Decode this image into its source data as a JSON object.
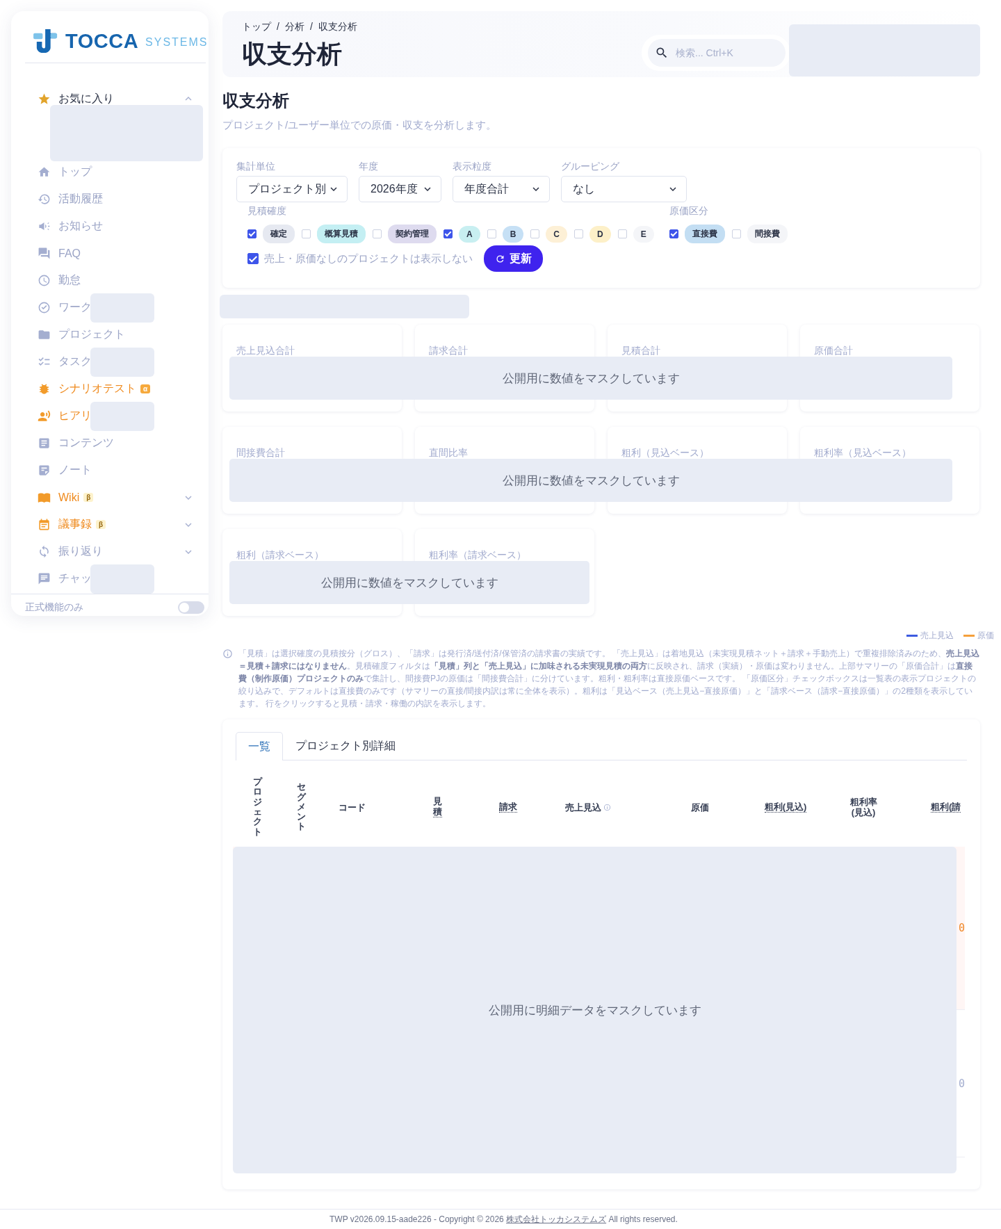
{
  "sidebar": {
    "logo": {
      "primary": "TOCCA",
      "secondary": "SYSTEMS"
    },
    "favorites": {
      "label": "お気に入り",
      "expanded": true,
      "masked": true
    },
    "items": [
      {
        "label": "トップ",
        "accent": false,
        "masked": false
      },
      {
        "label": "活動履歴",
        "accent": false,
        "masked": false
      },
      {
        "label": "お知らせ",
        "accent": false,
        "masked": false
      },
      {
        "label": "FAQ",
        "accent": false,
        "masked": false
      },
      {
        "label": "勤怠",
        "accent": false,
        "masked": false
      },
      {
        "label": "ワーク",
        "accent": false,
        "masked": true
      },
      {
        "label": "プロジェクト",
        "accent": false,
        "masked": false
      },
      {
        "label": "タスク",
        "accent": false,
        "masked": true
      },
      {
        "label": "シナリオテスト",
        "accent": true,
        "masked": false,
        "badge": {
          "text": "α",
          "kind": "solid"
        }
      },
      {
        "label": "ヒアリ",
        "accent": true,
        "masked": true
      },
      {
        "label": "コンテンツ",
        "accent": false,
        "masked": false
      },
      {
        "label": "ノート",
        "accent": false,
        "masked": false
      },
      {
        "label": "Wiki",
        "accent": true,
        "masked": false,
        "badge": {
          "text": "β",
          "kind": "soft"
        },
        "expanded": false
      },
      {
        "label": "議事録",
        "accent": true,
        "masked": false,
        "badge": {
          "text": "β",
          "kind": "soft"
        },
        "expanded": false
      },
      {
        "label": "振り返り",
        "accent": false,
        "masked": false,
        "expanded": false
      },
      {
        "label": "チャッ",
        "accent": false,
        "masked": true
      }
    ],
    "toggle": {
      "label": "正式機能のみ",
      "on": false
    }
  },
  "header": {
    "breadcrumb": [
      "トップ",
      "分析",
      "収支分析"
    ],
    "breadcrumb_separator": "/",
    "title": "収支分析",
    "search": {
      "placeholder": "検索... Ctrl+K"
    }
  },
  "page": {
    "title": "収支分析",
    "subtitle": "プロジェクト/ユーザー単位での原価・収支を分析します。"
  },
  "filters": {
    "selects": [
      {
        "label": "集計単位",
        "value": "プロジェクト別"
      },
      {
        "label": "年度",
        "value": "2026年度"
      },
      {
        "label": "表示粒度",
        "value": "年度合計"
      },
      {
        "label": "グルーピング",
        "value": "なし"
      }
    ],
    "groups": [
      {
        "label": "見積確度",
        "chips": [
          {
            "label": "確定",
            "checked": true,
            "color": "#e6e9f1"
          },
          {
            "label": "概算見積",
            "checked": false,
            "color": "#c4eff3"
          },
          {
            "label": "契約管理",
            "checked": false,
            "color": "#dedbef"
          },
          {
            "label": "A",
            "checked": true,
            "color": "#c8eff1"
          },
          {
            "label": "B",
            "checked": false,
            "color": "#c6e0f5"
          },
          {
            "label": "C",
            "checked": false,
            "color": "#fdf0d6"
          },
          {
            "label": "D",
            "checked": false,
            "color": "#fdf0c8"
          },
          {
            "label": "E",
            "checked": false,
            "color": "#f4f5f8"
          }
        ]
      },
      {
        "label": "原価区分",
        "chips": [
          {
            "label": "直接費",
            "checked": true,
            "color": "#c3def3"
          },
          {
            "label": "間接費",
            "checked": false,
            "color": "#f4f5f8"
          }
        ]
      }
    ],
    "hide_empty": {
      "label": "売上・原価なしのプロジェクトは表示しない",
      "checked": true
    },
    "refresh_button": "更新"
  },
  "summary": [
    {
      "cards": [
        "売上見込合計",
        "請求合計",
        "見積合計",
        "原価合計"
      ],
      "mask": "公開用に数値をマスクしています"
    },
    {
      "cards": [
        "間接費合計",
        "直間比率",
        "粗利（見込ベース）",
        "粗利率（見込ベース）"
      ],
      "mask": "公開用に数値をマスクしています"
    },
    {
      "cards": [
        "粗利（請求ベース）",
        "粗利率（請求ベース）"
      ],
      "mask": "公開用に数値をマスクしています"
    }
  ],
  "legend": [
    {
      "label": "売上見込",
      "color": "#3d5be0"
    },
    {
      "label": "原価",
      "color": "#f5a03c"
    }
  ],
  "note": "「見積」は選択確度の見積按分（グロス）、「請求」は発行済/送付済/保管済の請求書の実績です。 「売上見込」は着地見込（未実現見積ネット＋請求＋手動売上）で重複排除済みのため、**売上見込＝見積＋請求にはなりません**。見積確度フィルタは**「見積」列と「売上見込」に加味される未実現見積の両方**に反映され、請求（実績）・原価は変わりません。上部サマリーの「原価合計」は**直接費（制作原価）プロジェクトのみ**で集計し、間接費PJの原価は「間接費合計」に分けています。粗利・粗利率は直接原価ベースです。 「原価区分」チェックボックスは一覧表の表示プロジェクトの絞り込みで、デフォルトは直接費のみです（サマリーの直接/間接内訳は常に全体を表示）。粗利は「見込ベース（売上見込−直接原価）」と「請求ベース（請求−直接原価）」の2種類を表示しています。 行をクリックすると見積・請求・稼働の内訳を表示します。",
  "table": {
    "tabs": [
      {
        "label": "一覧",
        "selected": true
      },
      {
        "label": "プロジェクト別詳細",
        "selected": false
      }
    ],
    "columns": [
      {
        "label": "プロジェクト",
        "kind": "vertical"
      },
      {
        "label": "セグメント",
        "kind": "vertical"
      },
      {
        "label": "コード",
        "kind": "plain"
      },
      {
        "label": "見積",
        "kind": "vertical-dotted"
      },
      {
        "label": "請求",
        "kind": "dotted"
      },
      {
        "label": "売上見込",
        "kind": "info"
      },
      {
        "label": "原価",
        "kind": "plain"
      },
      {
        "label": "粗利(見込)",
        "kind": "dotted"
      },
      {
        "label": "粗利率\n(見込)",
        "kind": "plain"
      },
      {
        "label": "粗利(請",
        "kind": "dotted"
      }
    ],
    "rows": [
      {
        "negative": true,
        "last_cell": "0"
      },
      {
        "negative": false,
        "last_cell": "0"
      }
    ],
    "mask": "公開用に明細データをマスクしています"
  },
  "footer": {
    "before": "TWP v2026.09.15-aade226 - Copyright © 2026 ",
    "link": "株式会社トッカシステムズ",
    "after": " All rights reserved."
  }
}
